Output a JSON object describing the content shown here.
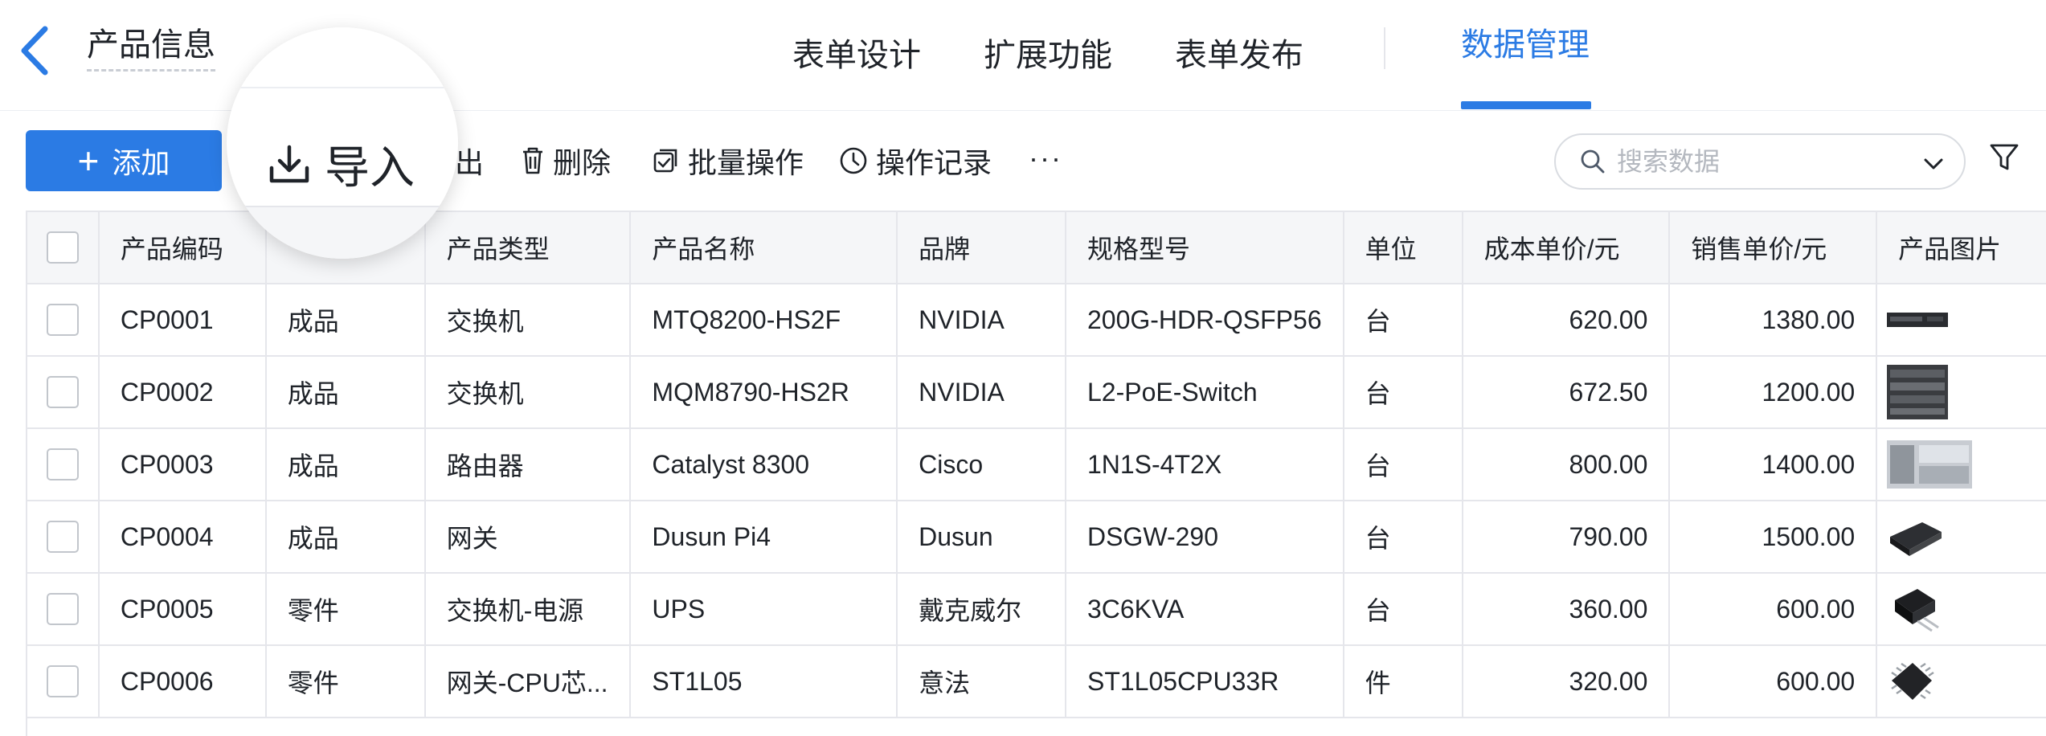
{
  "header": {
    "title": "产品信息",
    "tabs": [
      {
        "label": "表单设计"
      },
      {
        "label": "扩展功能"
      },
      {
        "label": "表单发布"
      }
    ],
    "active_tab": "数据管理",
    "accent_color": "#2b7be4"
  },
  "toolbar": {
    "add_label": "添加",
    "import_label": "导入",
    "export_label_visible": "出",
    "delete_label": "删除",
    "batch_label": "批量操作",
    "log_label": "操作记录",
    "more_label": "···",
    "search_placeholder": "搜索数据"
  },
  "table": {
    "columns": [
      "产品编码",
      "产品类型",
      "产品名称",
      "品牌",
      "规格型号",
      "单位",
      "成本单价/元",
      "销售单价/元",
      "产品图片"
    ],
    "rows": [
      {
        "code": "CP0001",
        "category": "成品",
        "type": "交换机",
        "name": "MTQ8200-HS2F",
        "brand": "NVIDIA",
        "model": "200G-HDR-QSFP56",
        "unit": "台",
        "cost": "620.00",
        "price": "1380.00",
        "image": "switch-image"
      },
      {
        "code": "CP0002",
        "category": "成品",
        "type": "交换机",
        "name": "MQM8790-HS2R",
        "brand": "NVIDIA",
        "model": "L2-PoE-Switch",
        "unit": "台",
        "cost": "672.50",
        "price": "1200.00",
        "image": "switch-rack-image"
      },
      {
        "code": "CP0003",
        "category": "成品",
        "type": "路由器",
        "name": "Catalyst 8300",
        "brand": "Cisco",
        "model": "1N1S-4T2X",
        "unit": "台",
        "cost": "800.00",
        "price": "1400.00",
        "image": "router-image"
      },
      {
        "code": "CP0004",
        "category": "成品",
        "type": "网关",
        "name": "Dusun Pi4",
        "brand": "Dusun",
        "model": "DSGW-290",
        "unit": "台",
        "cost": "790.00",
        "price": "1500.00",
        "image": "gateway-image"
      },
      {
        "code": "CP0005",
        "category": "零件",
        "type": "交换机-电源",
        "name": "UPS",
        "brand": "戴克威尔",
        "model": "3C6KVA",
        "unit": "台",
        "cost": "360.00",
        "price": "600.00",
        "image": "power-chip-image"
      },
      {
        "code": "CP0006",
        "category": "零件",
        "type": "网关-CPU芯...",
        "name": "ST1L05",
        "brand": "意法",
        "model": "ST1L05CPU33R",
        "unit": "件",
        "cost": "320.00",
        "price": "600.00",
        "image": "cpu-chip-image"
      }
    ]
  }
}
